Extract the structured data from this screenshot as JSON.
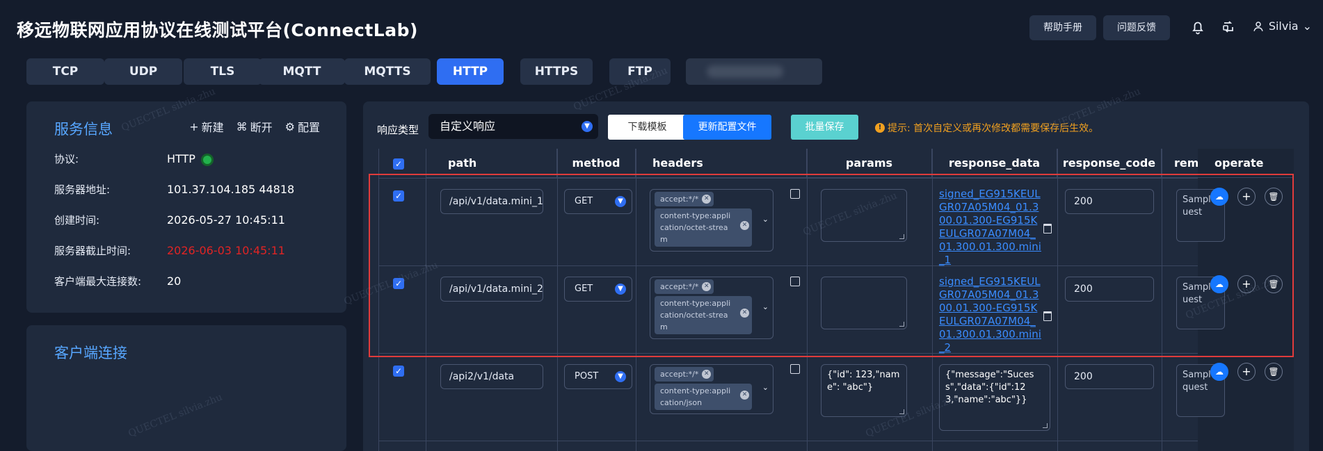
{
  "header": {
    "title": "移远物联网应用协议在线测试平台(ConnectLab)",
    "help_label": "帮助手册",
    "feedback_label": "问题反馈",
    "username": "Silvia"
  },
  "tabs": [
    {
      "label": "TCP"
    },
    {
      "label": "UDP"
    },
    {
      "label": "TLS"
    },
    {
      "label": "MQTT"
    },
    {
      "label": "MQTTS"
    },
    {
      "label": "HTTP"
    },
    {
      "label": "HTTPS"
    },
    {
      "label": "FTP"
    }
  ],
  "service": {
    "title": "服务信息",
    "actions": {
      "new": "新建",
      "disconnect": "断开",
      "config": "配置"
    },
    "protocol_label": "协议:",
    "protocol_value": "HTTP",
    "address_label": "服务器地址:",
    "address_value": "101.37.104.185 44818",
    "created_label": "创建时间:",
    "created_value": "2026-05-27 10:45:11",
    "expire_label": "服务器截止时间:",
    "expire_value": "2026-06-03 10:45:11",
    "maxconn_label": "客户端最大连接数:",
    "maxconn_value": "20"
  },
  "client": {
    "title": "客户端连接"
  },
  "toolbar": {
    "response_type_label": "响应类型",
    "response_type_value": "自定义响应",
    "download_template": "下载模板",
    "update_config": "更新配置文件",
    "batch_save": "批量保存",
    "tip": "提示:  首次自定义或再次修改都需要保存后生效。"
  },
  "table": {
    "headers": {
      "path": "path",
      "method": "method",
      "headers": "headers",
      "params": "params",
      "response_data": "response_data",
      "response_code": "response_code",
      "remark": "remar",
      "operate": "operate"
    },
    "rows": [
      {
        "path": "/api/v1/data.mini_1",
        "method": "GET",
        "tag1": "accept:*/*",
        "tag2": "content-type:appli cation/octet-strea m",
        "params": "",
        "response": "signed_EG915KEULGR07A05M04_01.300.01.300-EG915KEULGR07A07M04_01.300.01.300.mini_1",
        "code": "200",
        "remark": "Sample uest"
      },
      {
        "path": "/api/v1/data.mini_2",
        "method": "GET",
        "tag1": "accept:*/*",
        "tag2": "content-type:appli cation/octet-strea m",
        "params": "",
        "response": "signed_EG915KEULGR07A05M04_01.300.01.300-EG915KEULGR07A07M04_01.300.01.300.mini_2",
        "code": "200",
        "remark": "Sample uest"
      },
      {
        "path": "/api2/v1/data",
        "method": "POST",
        "tag1": "accept:*/*",
        "tag2": "content-type:appli cation/json",
        "params": "{\"id\": 123,\"name\": \"abc\"}",
        "response": "{\"message\":\"Sucess\",\"data\":{\"id\":123,\"name\":\"abc\"}}",
        "code": "200",
        "remark": "Sample quest"
      }
    ]
  },
  "watermark": "QUECTEL silvia.zhu"
}
